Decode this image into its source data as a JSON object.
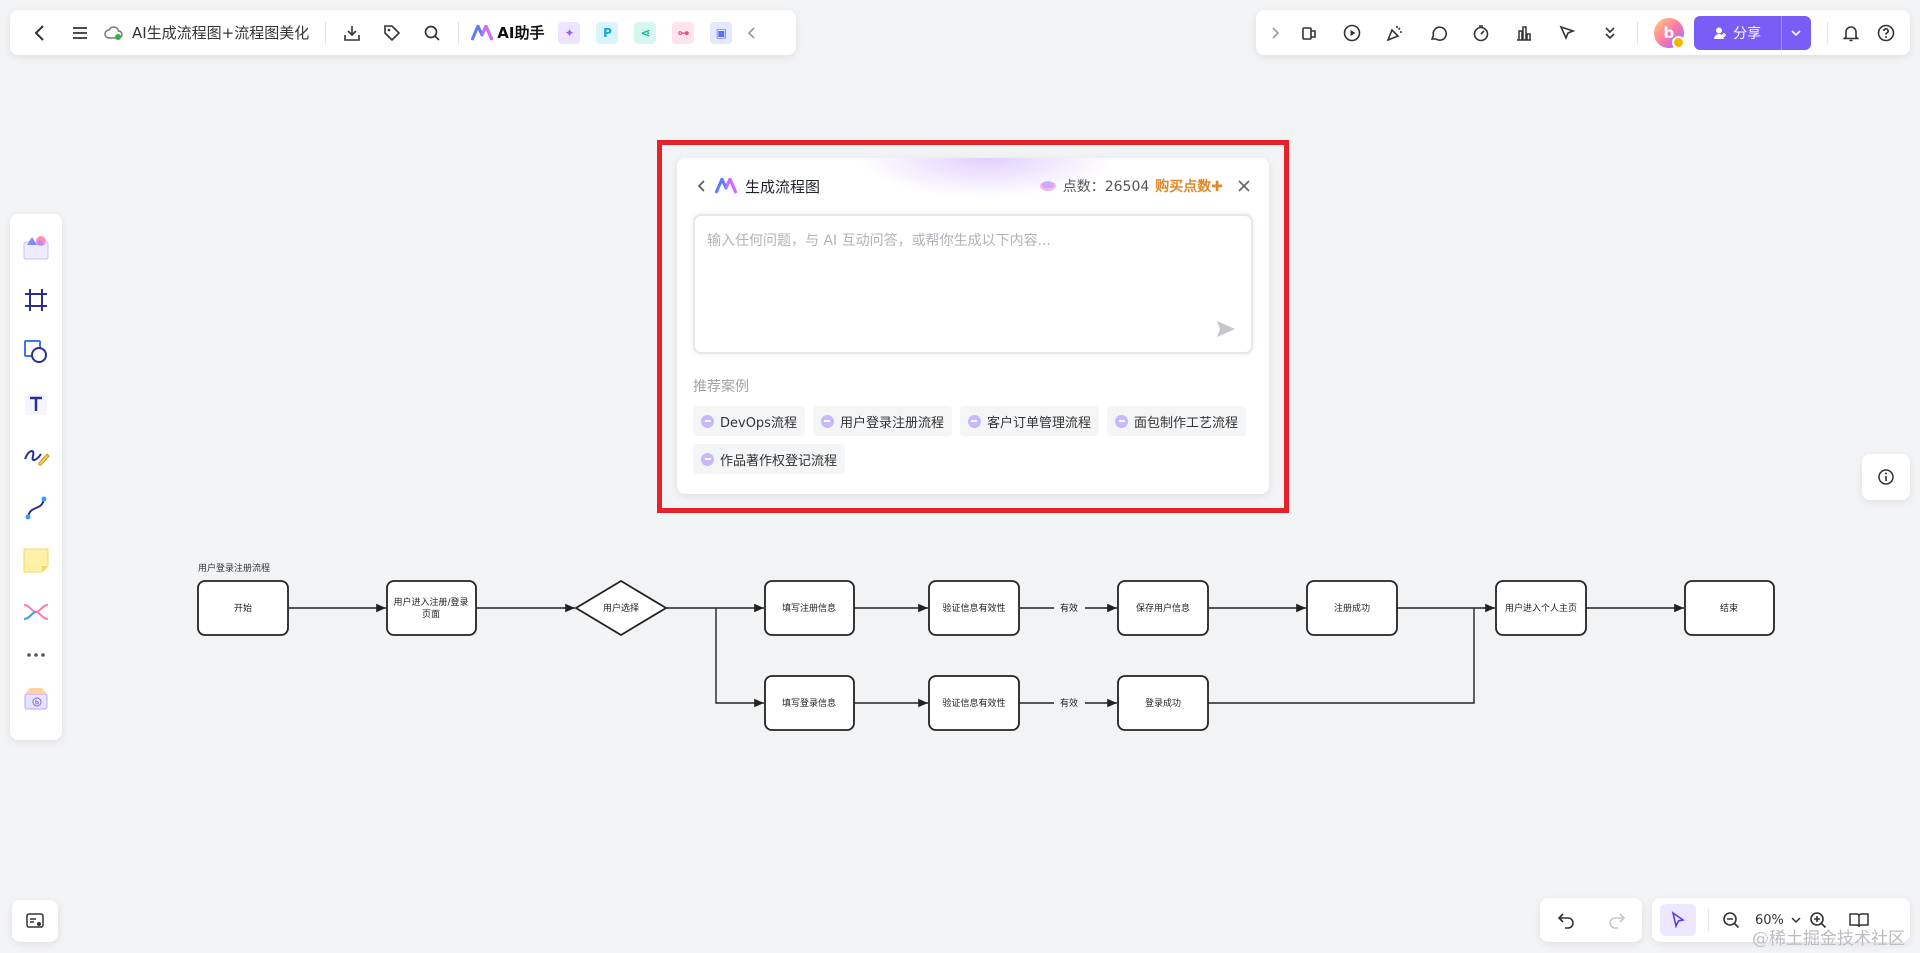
{
  "toolbar_left": {
    "title": "AI生成流程图+流程图美化",
    "ai_label": "AI助手",
    "p_label": "P"
  },
  "toolbar_right": {
    "avatar_letter": "b",
    "share_label": "分享"
  },
  "dialog": {
    "title": "生成流程图",
    "points_label": "点数：26504",
    "buy_label": "购买点数",
    "input_placeholder": "输入任何问题，与 AI 互动问答，或帮你生成以下内容...",
    "recommend_label": "推荐案例",
    "examples": [
      "DevOps流程",
      "用户登录注册流程",
      "客户订单管理流程",
      "面包制作工艺流程",
      "作品著作权登记流程"
    ]
  },
  "flowchart": {
    "title": "用户登录注册流程",
    "nodes": {
      "start": "开始",
      "enter": "用户进入注册/登录",
      "enter2": "页面",
      "choice": "用户选择",
      "fill_reg": "填写注册信息",
      "verify1": "验证信息有效性",
      "save": "保存用户信息",
      "reg_ok": "注册成功",
      "home": "用户进入个人主页",
      "end": "结束",
      "fill_login": "填写登录信息",
      "verify2": "验证信息有效性",
      "login_ok": "登录成功"
    },
    "edge_valid": "有效"
  },
  "zoom": {
    "value": "60%"
  },
  "watermark": "@稀土掘金技术社区",
  "colors": {
    "accent": "#7a5cf6",
    "highlight": "#e8202a",
    "buy": "#e0892a"
  }
}
